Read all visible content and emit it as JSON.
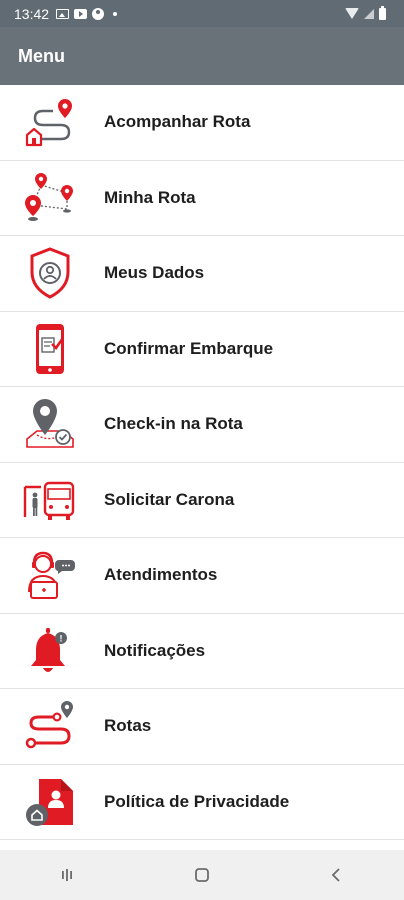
{
  "status_bar": {
    "time": "13:42",
    "icons": [
      "image-icon",
      "youtube-icon",
      "account-icon",
      "dot-icon",
      "wifi-icon",
      "signal-icon",
      "battery-icon"
    ]
  },
  "app_bar": {
    "title": "Menu"
  },
  "colors": {
    "accent": "#e01b24",
    "dark": "#5f6368",
    "app_bar": "#6a7279",
    "status_bar": "#616b73"
  },
  "menu": {
    "items": [
      {
        "label": "Acompanhar Rota",
        "icon": "route-tracking-icon"
      },
      {
        "label": "Minha Rota",
        "icon": "map-pins-route-icon"
      },
      {
        "label": "Meus Dados",
        "icon": "user-shield-icon"
      },
      {
        "label": "Confirmar Embarque",
        "icon": "phone-check-icon"
      },
      {
        "label": "Check-in na Rota",
        "icon": "location-check-icon"
      },
      {
        "label": "Solicitar Carona",
        "icon": "bus-stop-icon"
      },
      {
        "label": "Atendimentos",
        "icon": "support-agent-icon"
      },
      {
        "label": "Notificações",
        "icon": "bell-icon"
      },
      {
        "label": "Rotas",
        "icon": "routes-icon"
      },
      {
        "label": "Política de Privacidade",
        "icon": "privacy-document-icon"
      }
    ]
  },
  "nav_bar": {
    "buttons": [
      "recent-apps-icon",
      "home-icon",
      "back-icon"
    ]
  }
}
